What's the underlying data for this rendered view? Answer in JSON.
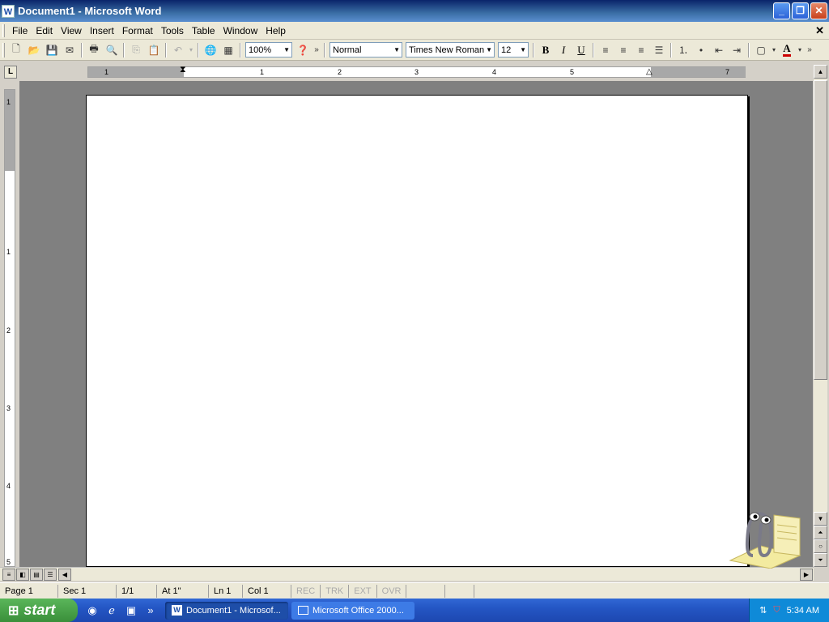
{
  "window": {
    "title": "Document1 - Microsoft Word",
    "app_icon": "W",
    "minimize": "_",
    "maximize": "❐",
    "close": "✕"
  },
  "menu": {
    "items": [
      "File",
      "Edit",
      "View",
      "Insert",
      "Format",
      "Tools",
      "Table",
      "Window",
      "Help"
    ],
    "close": "✕"
  },
  "toolbar": {
    "zoom": "100%",
    "style": "Normal",
    "font": "Times New Roman",
    "size": "12",
    "bold": "B",
    "italic": "I",
    "underline": "U",
    "font_color_label": "A",
    "font_color": "#cc0000"
  },
  "ruler": {
    "tab_selector": "L",
    "h_numbers": [
      "1",
      "1",
      "2",
      "3",
      "4",
      "5",
      "7"
    ],
    "v_numbers": [
      "1",
      "1",
      "2",
      "3",
      "4",
      "5"
    ]
  },
  "statusbar": {
    "page": "Page 1",
    "sec": "Sec 1",
    "pages": "1/1",
    "at": "At 1\"",
    "ln": "Ln 1",
    "col": "Col 1",
    "rec": "REC",
    "trk": "TRK",
    "ext": "EXT",
    "ovr": "OVR"
  },
  "taskbar": {
    "start": "start",
    "tasks": [
      {
        "label": "Document1 - Microsof...",
        "icon": "word-icon"
      },
      {
        "label": "Microsoft Office 2000...",
        "icon": "window-icon"
      }
    ],
    "clock": "5:34 AM"
  }
}
